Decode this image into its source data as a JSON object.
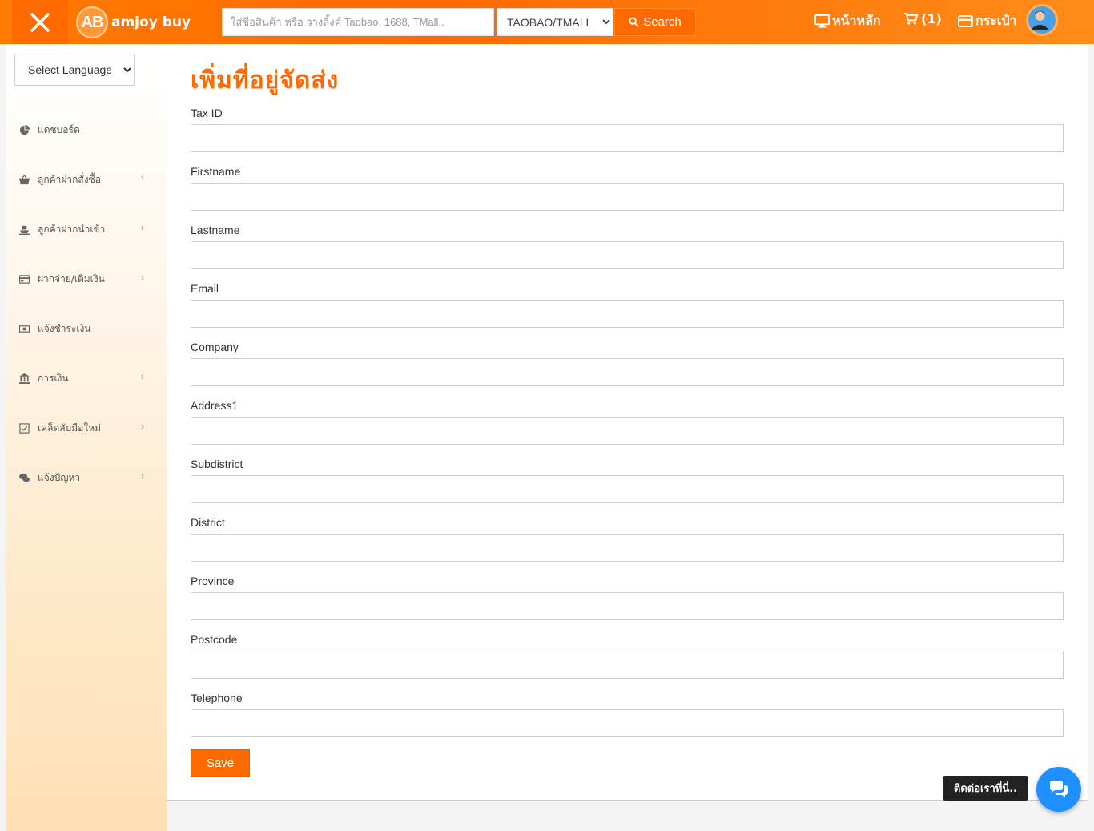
{
  "header": {
    "logo_mark": "AB",
    "logo_text": "amjoy buy",
    "search_placeholder": "ใส่ชื่อสินค้า หรือ วางลิ้งค์ Taobao, 1688, TMall..",
    "search_source": "TAOBAO/TMALL",
    "search_button": "Search",
    "nav": {
      "home": "หน้าหลัก",
      "cart": "(1)",
      "wallet": "กระเป๋า"
    }
  },
  "sidebar": {
    "language_select": "Select Language",
    "items": [
      {
        "label": "แดชบอร์ด",
        "icon": "pie-chart-icon",
        "has_submenu": false
      },
      {
        "label": "ลูกค้าฝากสั่งซื้อ",
        "icon": "basket-icon",
        "has_submenu": true
      },
      {
        "label": "ลูกค้าฝากนำเข้า",
        "icon": "ship-icon",
        "has_submenu": true
      },
      {
        "label": "ฝากจ่าย/เติมเงิน",
        "icon": "credit-card-icon",
        "has_submenu": true
      },
      {
        "label": "แจ้งชำระเงิน",
        "icon": "money-icon",
        "has_submenu": false
      },
      {
        "label": "การเงิน",
        "icon": "bank-icon",
        "has_submenu": true
      },
      {
        "label": "เคล็ดลับมือใหม่",
        "icon": "checkbox-icon",
        "has_submenu": true
      },
      {
        "label": "แจ้งปัญหา",
        "icon": "comments-icon",
        "has_submenu": true
      }
    ]
  },
  "main": {
    "title": "เพิ่มที่อยู่จัดส่ง",
    "fields": [
      {
        "label": "Tax ID",
        "value": ""
      },
      {
        "label": "Firstname",
        "value": ""
      },
      {
        "label": "Lastname",
        "value": ""
      },
      {
        "label": "Email",
        "value": ""
      },
      {
        "label": "Company",
        "value": ""
      },
      {
        "label": "Address1",
        "value": ""
      },
      {
        "label": "Subdistrict",
        "value": ""
      },
      {
        "label": "District",
        "value": ""
      },
      {
        "label": "Province",
        "value": ""
      },
      {
        "label": "Postcode",
        "value": ""
      },
      {
        "label": "Telephone",
        "value": ""
      }
    ],
    "save_button": "Save"
  },
  "chat": {
    "label": "ติดต่อเราที่นี่.."
  },
  "colors": {
    "accent": "#ff6a00",
    "chat_blue": "#1e90ff"
  }
}
